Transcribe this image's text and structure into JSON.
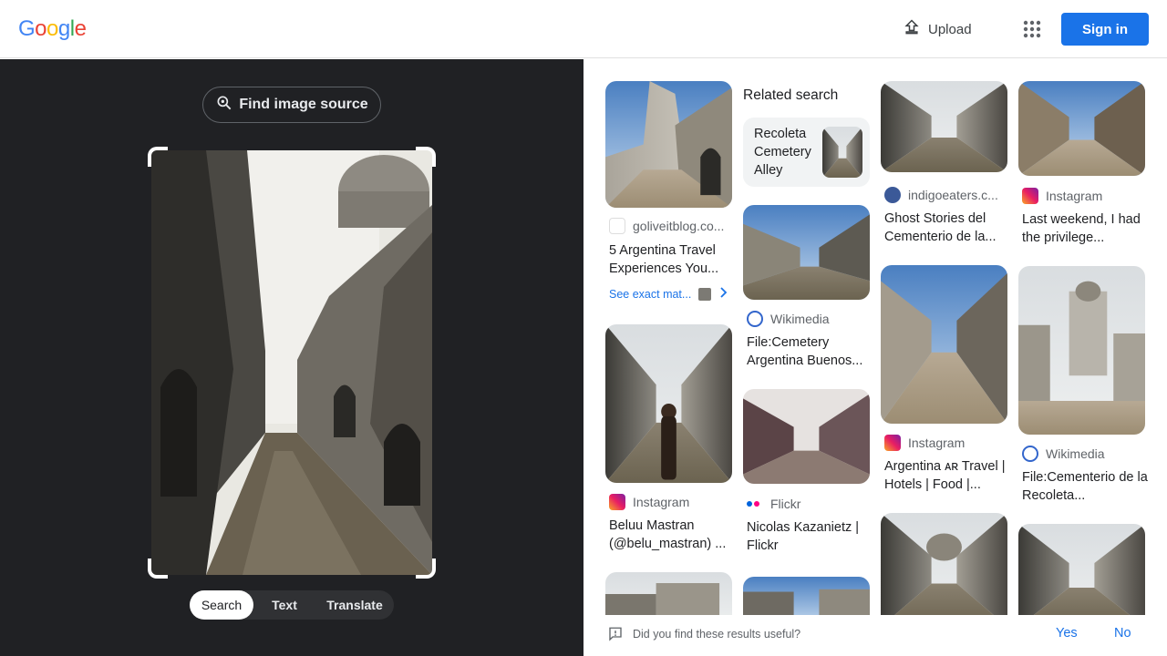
{
  "header": {
    "logo_letters": [
      {
        "ch": "G",
        "color": "#4285F4"
      },
      {
        "ch": "o",
        "color": "#EA4335"
      },
      {
        "ch": "o",
        "color": "#FBBC05"
      },
      {
        "ch": "g",
        "color": "#4285F4"
      },
      {
        "ch": "l",
        "color": "#34A853"
      },
      {
        "ch": "e",
        "color": "#EA4335"
      }
    ],
    "upload_label": "Upload",
    "upload_icon": "upload-icon",
    "apps_icon": "apps-grid-icon",
    "signin_label": "Sign in"
  },
  "left": {
    "find_source_label": "Find image source",
    "modes": [
      "Search",
      "Text",
      "Translate"
    ],
    "active_mode": "Search"
  },
  "results": {
    "related_heading": "Related search",
    "related_item": "Recoleta Cemetery Alley",
    "see_exact": "See exact mat...",
    "cards": [
      {
        "source": "goliveitblog.co...",
        "title": "5 Argentina Travel Experiences You...",
        "icon": "blog-icon"
      },
      {
        "source": "Instagram",
        "title": "Beluu Mastran (@belu_mastran) ...",
        "icon": "instagram-icon"
      },
      {
        "source": "Wikimedia",
        "title": "File:Cemetery Argentina Buenos...",
        "icon": "wikimedia-icon"
      },
      {
        "source": "Flickr",
        "title": "Nicolas Kazanietz | Flickr",
        "icon": "flickr-icon"
      },
      {
        "source": "indigoeaters.c...",
        "title": "Ghost Stories del Cementerio de la...",
        "icon": "wordpress-icon"
      },
      {
        "source": "Instagram",
        "title": "Argentina ᴀʀ Travel | Hotels | Food |...",
        "icon": "instagram-icon"
      },
      {
        "source": "Instagram",
        "title": "Last weekend, I had the privilege...",
        "icon": "instagram-icon"
      },
      {
        "source": "Wikimedia",
        "title": "File:Cementerio de la Recoleta...",
        "icon": "wikimedia-icon"
      }
    ]
  },
  "feedback": {
    "question": "Did you find these results useful?",
    "yes": "Yes",
    "no": "No"
  }
}
